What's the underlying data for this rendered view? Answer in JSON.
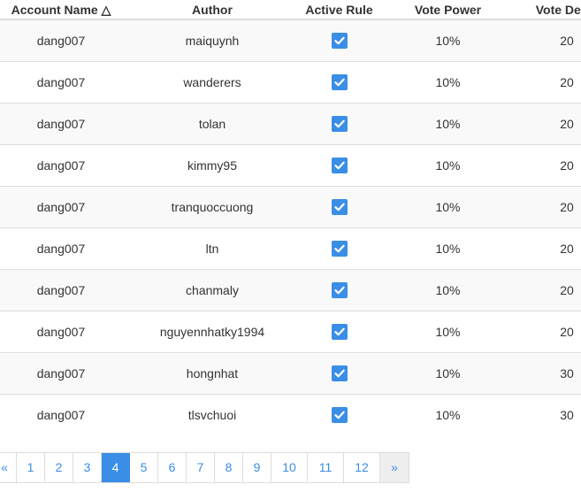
{
  "table": {
    "headers": {
      "account_name": "Account Name △",
      "author": "Author",
      "active_rule": "Active Rule",
      "vote_power": "Vote Power",
      "vote_delay": "Vote Delay"
    },
    "rows": [
      {
        "account": "dang007",
        "author": "maiquynh",
        "active": true,
        "power": "10%",
        "delay": "20"
      },
      {
        "account": "dang007",
        "author": "wanderers",
        "active": true,
        "power": "10%",
        "delay": "20"
      },
      {
        "account": "dang007",
        "author": "tolan",
        "active": true,
        "power": "10%",
        "delay": "20"
      },
      {
        "account": "dang007",
        "author": "kimmy95",
        "active": true,
        "power": "10%",
        "delay": "20"
      },
      {
        "account": "dang007",
        "author": "tranquoccuong",
        "active": true,
        "power": "10%",
        "delay": "20"
      },
      {
        "account": "dang007",
        "author": "ltn",
        "active": true,
        "power": "10%",
        "delay": "20"
      },
      {
        "account": "dang007",
        "author": "chanmaly",
        "active": true,
        "power": "10%",
        "delay": "20"
      },
      {
        "account": "dang007",
        "author": "nguyennhatky1994",
        "active": true,
        "power": "10%",
        "delay": "20"
      },
      {
        "account": "dang007",
        "author": "hongnhat",
        "active": true,
        "power": "10%",
        "delay": "30"
      },
      {
        "account": "dang007",
        "author": "tlsvchuoi",
        "active": true,
        "power": "10%",
        "delay": "30"
      }
    ]
  },
  "pagination": {
    "prev_label": "«",
    "next_label": "»",
    "pages": [
      "1",
      "2",
      "3",
      "4",
      "5",
      "6",
      "7",
      "8",
      "9",
      "10",
      "11",
      "12"
    ],
    "current_page": "4"
  },
  "colors": {
    "accent": "#3a8ee6",
    "row_stripe": "#f9f9f9",
    "border": "#dddddd"
  },
  "icons": {
    "checkbox": "checkbox-checked-icon"
  }
}
